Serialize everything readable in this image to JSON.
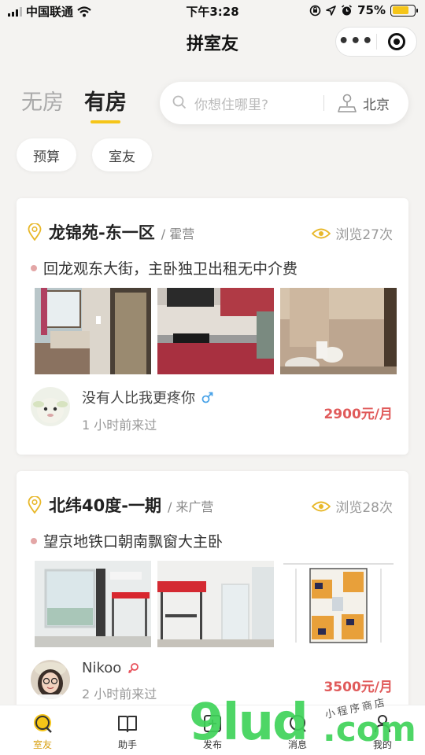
{
  "status_bar": {
    "carrier": "中国联通",
    "time": "下午3:28",
    "battery": "75%",
    "battery_level": 0.75
  },
  "nav": {
    "title": "拼室友",
    "more": "•••"
  },
  "tabs": [
    {
      "label": "无房",
      "active": false
    },
    {
      "label": "有房",
      "active": true
    }
  ],
  "search": {
    "placeholder": "你想住哪里?",
    "city": "北京"
  },
  "filters": [
    "预算",
    "室友"
  ],
  "listings": [
    {
      "title": "龙锦苑-东一区",
      "area": "/ 霍营",
      "views": "浏览27次",
      "description": "回龙观东大街，主卧独卫出租无中介费",
      "poster": "没有人比我更疼你",
      "gender": "male",
      "time": "1 小时前来过",
      "price": "2900元/月"
    },
    {
      "title": "北纬40度-一期",
      "area": "/ 来广营",
      "views": "浏览28次",
      "description": "望京地铁口朝南飘窗大主卧",
      "poster": "Nikoo",
      "gender": "female",
      "time": "2 小时前来过",
      "price": "3500元/月"
    }
  ],
  "tabbar": [
    {
      "label": "室友",
      "icon": "roommate-icon",
      "active": true
    },
    {
      "label": "助手",
      "icon": "book-icon",
      "active": false
    },
    {
      "label": "发布",
      "icon": "publish-icon",
      "active": false
    },
    {
      "label": "消息",
      "icon": "message-icon",
      "active": false
    },
    {
      "label": "我的",
      "icon": "profile-icon",
      "active": false
    }
  ],
  "watermark": {
    "brand": "9lud",
    "domain": ".com",
    "caption": "小程序商店"
  },
  "colors": {
    "accent": "#f5c518",
    "price": "#e05a5a",
    "background": "#f4f3f1"
  }
}
